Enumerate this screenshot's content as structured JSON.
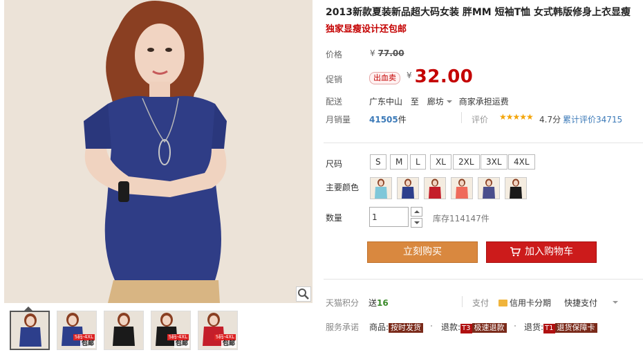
{
  "product": {
    "title": "2013新款夏装新品超大码女装 胖MM 短袖T恤 女式韩版修身上衣显瘦",
    "subtitle": "独家显瘦设计还包邮"
  },
  "gallery": {
    "thumbnails": [
      {
        "color": "#2d3f8c",
        "badge": ""
      },
      {
        "color": "#2d3f8c",
        "badge": "包邮",
        "badge2": "S码-4XL"
      },
      {
        "color": "#1a1a1a",
        "badge": ""
      },
      {
        "color": "#1a1a1a",
        "badge": "包邮",
        "badge2": "S码-4XL"
      },
      {
        "color": "#c41e2a",
        "badge": "包邮",
        "badge2": "S码-4XL"
      }
    ]
  },
  "price": {
    "label": "价格",
    "currency": "¥",
    "original": "77.00"
  },
  "promo": {
    "label": "促销",
    "tag": "出血卖",
    "currency": "¥",
    "price": "32.00"
  },
  "shipping": {
    "label": "配送",
    "from": "广东中山",
    "to_word": "至",
    "dest": "廊坊",
    "note": "商家承担运费"
  },
  "sales": {
    "label": "月销量",
    "count": "41505",
    "unit": "件"
  },
  "reviews": {
    "label": "评价",
    "stars": "★★★★★",
    "score": "4.7分",
    "count_text": "累计评价34715"
  },
  "size": {
    "label": "尺码",
    "options": [
      "S",
      "M",
      "L",
      "XL",
      "2XL",
      "3XL",
      "4XL"
    ]
  },
  "colors": {
    "label": "主要颜色",
    "swatches": [
      "#7fc7d9",
      "#2d3f8c",
      "#c41e2a",
      "#ef6a5a",
      "#4a4e8c",
      "#1a1a1a"
    ]
  },
  "quantity": {
    "label": "数量",
    "value": "1",
    "stock": "库存114147件"
  },
  "actions": {
    "buy_now": "立刻购买",
    "add_to_cart": "加入购物车"
  },
  "points": {
    "label": "天猫积分",
    "prefix": "送",
    "value": "16"
  },
  "payment": {
    "label": "支付",
    "credit": "信用卡分期",
    "quick": "快捷支付"
  },
  "service": {
    "label": "服务承诺",
    "items": [
      {
        "prefix": "商品:",
        "tag": "按时发货"
      },
      {
        "prefix": "退款:",
        "code": "T3",
        "tag": "极速退款"
      },
      {
        "prefix": "退货:",
        "code": "T1",
        "tag": "退货保障卡"
      }
    ]
  }
}
